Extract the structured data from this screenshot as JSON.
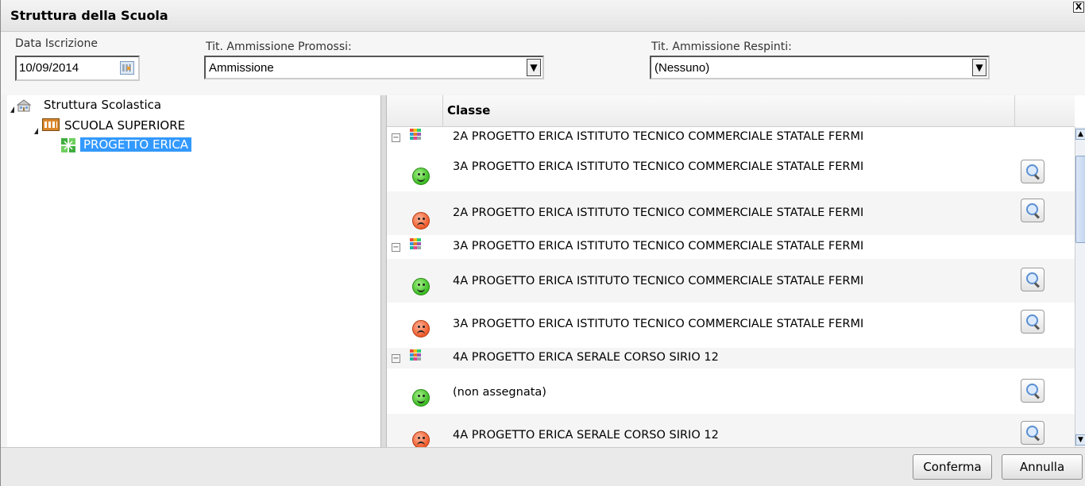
{
  "dialog": {
    "title": "Struttura della Scuola",
    "close_label": "X"
  },
  "form": {
    "date_label": "Data Iscrizione",
    "date_value": "10/09/2014",
    "promossi_label": "Tit. Ammissione Promossi:",
    "promossi_value": "Ammissione",
    "respinti_label": "Tit. Ammissione Respinti:",
    "respinti_value": "(Nessuno)"
  },
  "tree": {
    "root": "Struttura Scolastica",
    "level1": "SCUOLA SUPERIORE",
    "level2": "PROGETTO ERICA"
  },
  "grid": {
    "column_header": "Classe",
    "groups": [
      {
        "label": "2A PROGETTO ERICA ISTITUTO TECNICO COMMERCIALE STATALE FERMI",
        "items": [
          {
            "status": "promosso",
            "label": "3A PROGETTO ERICA ISTITUTO TECNICO COMMERCIALE STATALE FERMI"
          },
          {
            "status": "respinto",
            "label": "2A PROGETTO ERICA ISTITUTO TECNICO COMMERCIALE STATALE FERMI"
          }
        ]
      },
      {
        "label": "3A PROGETTO ERICA ISTITUTO TECNICO COMMERCIALE STATALE FERMI",
        "items": [
          {
            "status": "promosso",
            "label": "4A PROGETTO ERICA ISTITUTO TECNICO COMMERCIALE STATALE FERMI"
          },
          {
            "status": "respinto",
            "label": "3A PROGETTO ERICA ISTITUTO TECNICO COMMERCIALE STATALE FERMI"
          }
        ]
      },
      {
        "label": "4A PROGETTO ERICA SERALE CORSO SIRIO 12",
        "items": [
          {
            "status": "promosso",
            "label": "(non assegnata)"
          },
          {
            "status": "respinto",
            "label": "4A PROGETTO ERICA SERALE CORSO SIRIO 12"
          }
        ]
      }
    ]
  },
  "footer": {
    "confirm_label": "Conferma",
    "cancel_label": "Annulla"
  },
  "colors": {
    "selection": "#3399ff",
    "promosso": "#3bbb22",
    "respinto": "#ef5a2a"
  }
}
